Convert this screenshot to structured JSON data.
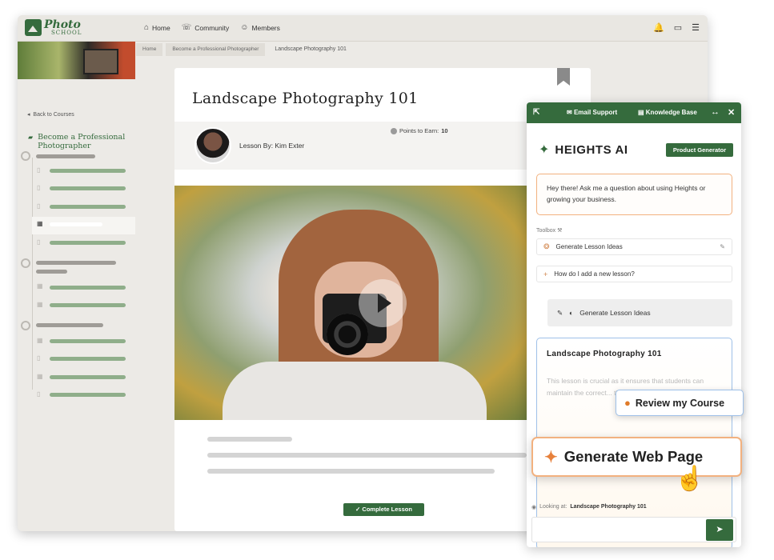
{
  "logo": {
    "line1": "Photo",
    "line2": "SCHOOL"
  },
  "nav": [
    {
      "label": "Home",
      "icon": "home-icon"
    },
    {
      "label": "Community",
      "icon": "chat-icon"
    },
    {
      "label": "Members",
      "icon": "members-icon"
    }
  ],
  "top_icons": [
    "bell-icon",
    "inbox-icon",
    "menu-icon"
  ],
  "sidebar": {
    "back_label": "Back to Courses",
    "course_title": "Become a Professional Photographer"
  },
  "breadcrumb": [
    "Home",
    "Become a Professional Photographer",
    "Landscape Photography 101"
  ],
  "lesson": {
    "title": "Landscape Photography 101",
    "by": "Lesson By: Kim Exter",
    "points_label": "Points to Earn:",
    "points_value": "10",
    "complete_label": "Complete Lesson"
  },
  "ai": {
    "email_support": "Email Support",
    "knowledge_base": "Knowledge Base",
    "brand": "HEIGHTS AI",
    "badge": "Product Generator",
    "greeting": "Hey there! Ask me a question about using Heights or growing your business.",
    "toolbox_label": "Toolbox",
    "tools": [
      "Generate Lesson Ideas",
      "How do I add a new lesson?"
    ],
    "chip_label": "Generate Lesson Ideas",
    "lesson_title": "Landscape Photography 101",
    "lesson_preview": "This lesson is crucial as it ensures that students can maintain the correct... their guide. Proced...",
    "looking_prefix": "Looking at:",
    "looking_value": "Landscape Photography 101"
  },
  "floating": {
    "review": "Review my Course",
    "generate": "Generate Web Page"
  },
  "colors": {
    "brand_green": "#356b3d",
    "accent_orange": "#e7813c"
  }
}
